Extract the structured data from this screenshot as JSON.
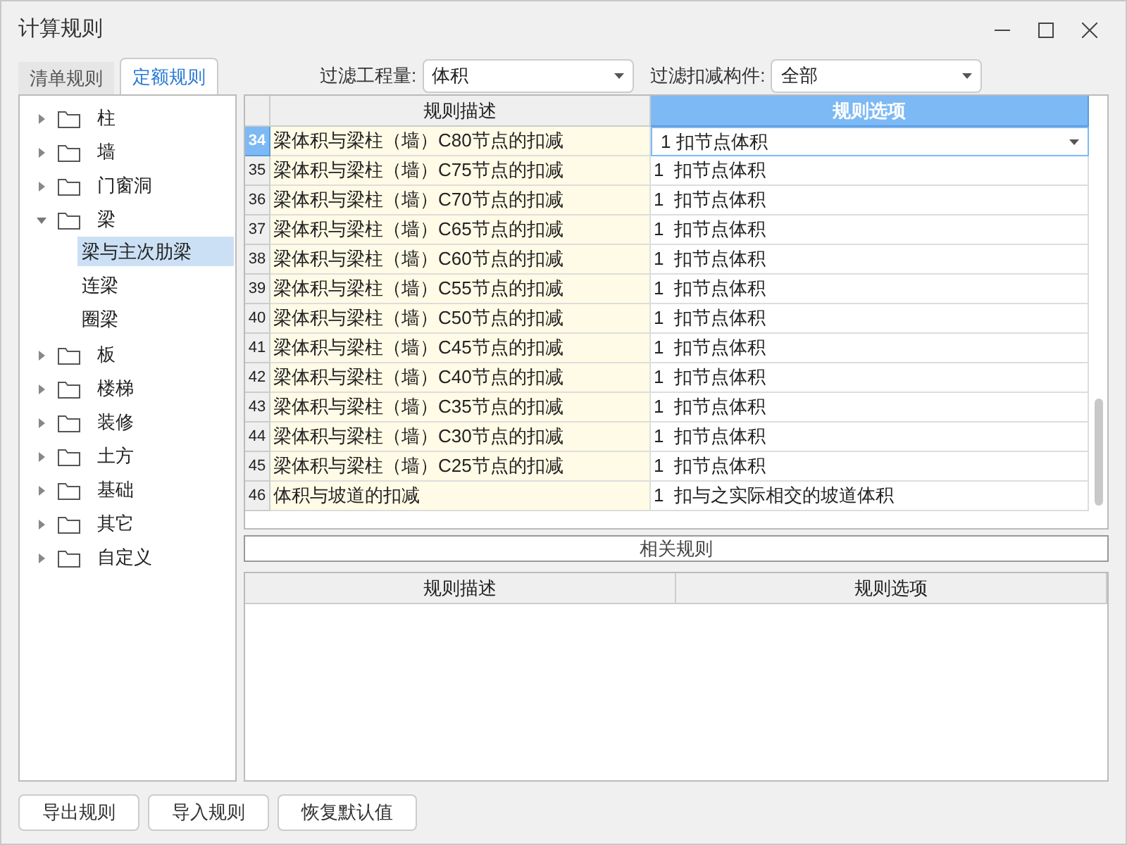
{
  "window": {
    "title": "计算规则"
  },
  "tabs": [
    {
      "label": "清单规则",
      "selected": false
    },
    {
      "label": "定额规则",
      "selected": true
    }
  ],
  "filters": [
    {
      "label": "过滤工程量:",
      "value": "体积"
    },
    {
      "label": "过滤扣减构件:",
      "value": "全部"
    }
  ],
  "tree": [
    {
      "label": "柱",
      "expanded": false
    },
    {
      "label": "墙",
      "expanded": false
    },
    {
      "label": "门窗洞",
      "expanded": false
    },
    {
      "label": "梁",
      "expanded": true,
      "children": [
        {
          "label": "梁与主次肋梁",
          "selected": true
        },
        {
          "label": "连梁",
          "selected": false
        },
        {
          "label": "圈梁",
          "selected": false
        }
      ]
    },
    {
      "label": "板",
      "expanded": false
    },
    {
      "label": "楼梯",
      "expanded": false
    },
    {
      "label": "装修",
      "expanded": false
    },
    {
      "label": "土方",
      "expanded": false
    },
    {
      "label": "基础",
      "expanded": false
    },
    {
      "label": "其它",
      "expanded": false
    },
    {
      "label": "自定义",
      "expanded": false
    }
  ],
  "table": {
    "columns": [
      {
        "label": "规则描述",
        "selected": false
      },
      {
        "label": "规则选项",
        "selected": true
      }
    ],
    "rows": [
      {
        "number": "34",
        "description": "梁体积与梁柱（墙）C80节点的扣减",
        "option": "1 扣节点体积",
        "selected": true
      },
      {
        "number": "35",
        "description": "梁体积与梁柱（墙）C75节点的扣减",
        "option": "1  扣节点体积",
        "selected": false
      },
      {
        "number": "36",
        "description": "梁体积与梁柱（墙）C70节点的扣减",
        "option": "1  扣节点体积",
        "selected": false
      },
      {
        "number": "37",
        "description": "梁体积与梁柱（墙）C65节点的扣减",
        "option": "1  扣节点体积",
        "selected": false
      },
      {
        "number": "38",
        "description": "梁体积与梁柱（墙）C60节点的扣减",
        "option": "1  扣节点体积",
        "selected": false
      },
      {
        "number": "39",
        "description": "梁体积与梁柱（墙）C55节点的扣减",
        "option": "1  扣节点体积",
        "selected": false
      },
      {
        "number": "40",
        "description": "梁体积与梁柱（墙）C50节点的扣减",
        "option": "1  扣节点体积",
        "selected": false
      },
      {
        "number": "41",
        "description": "梁体积与梁柱（墙）C45节点的扣减",
        "option": "1  扣节点体积",
        "selected": false
      },
      {
        "number": "42",
        "description": "梁体积与梁柱（墙）C40节点的扣减",
        "option": "1  扣节点体积",
        "selected": false
      },
      {
        "number": "43",
        "description": "梁体积与梁柱（墙）C35节点的扣减",
        "option": "1  扣节点体积",
        "selected": false
      },
      {
        "number": "44",
        "description": "梁体积与梁柱（墙）C30节点的扣减",
        "option": "1  扣节点体积",
        "selected": false
      },
      {
        "number": "45",
        "description": "梁体积与梁柱（墙）C25节点的扣减",
        "option": "1  扣节点体积",
        "selected": false
      },
      {
        "number": "46",
        "description": "体积与坡道的扣减",
        "option": "1  扣与之实际相交的坡道体积",
        "selected": false
      }
    ]
  },
  "related": {
    "title": "相关规则",
    "columns": [
      "规则描述",
      "规则选项"
    ]
  },
  "buttons": [
    "导出规则",
    "导入规则",
    "恢复默认值"
  ]
}
